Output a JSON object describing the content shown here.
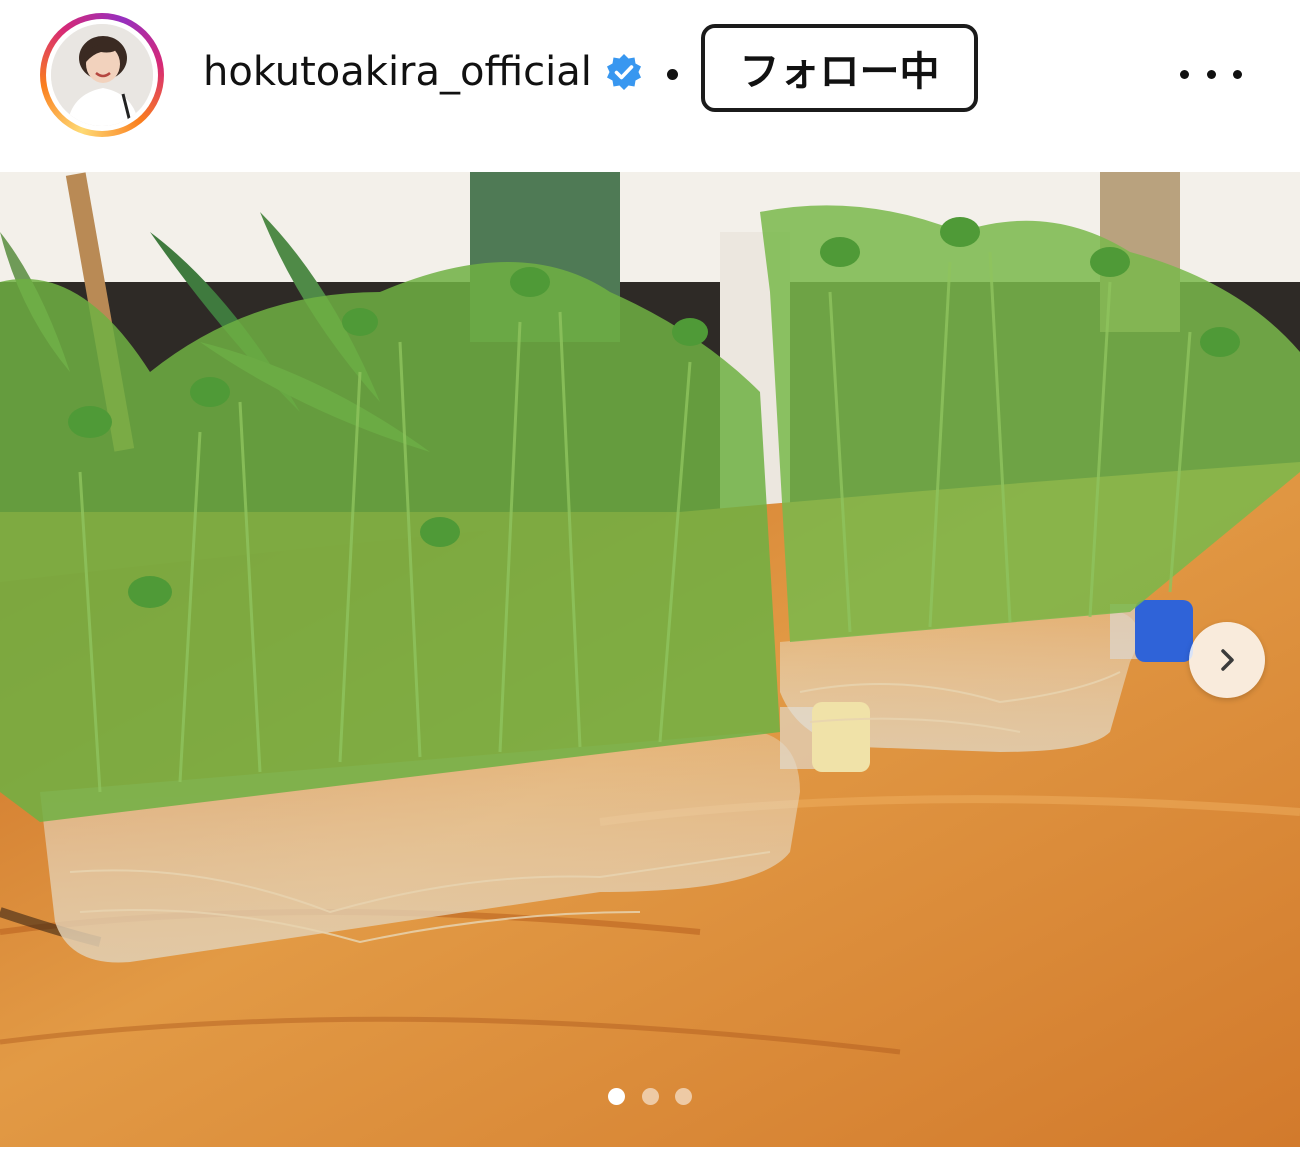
{
  "header": {
    "username": "hokutoakira_official",
    "verified": true,
    "separator": "•",
    "follow_label": "フォロー中",
    "more_icon": "more-horizontal-icon",
    "avatar_icon": "profile-avatar"
  },
  "post": {
    "image_description_icon": "post-photo",
    "next_icon": "chevron-right-icon",
    "carousel": {
      "total": 3,
      "active_index": 0
    }
  },
  "colors": {
    "verified_blue": "#3897f0",
    "story_ring_start": "#feda75",
    "story_ring_end": "#d62976",
    "dot_active": "#ffffff",
    "dot_inactive": "rgba(255,255,255,0.55)"
  }
}
